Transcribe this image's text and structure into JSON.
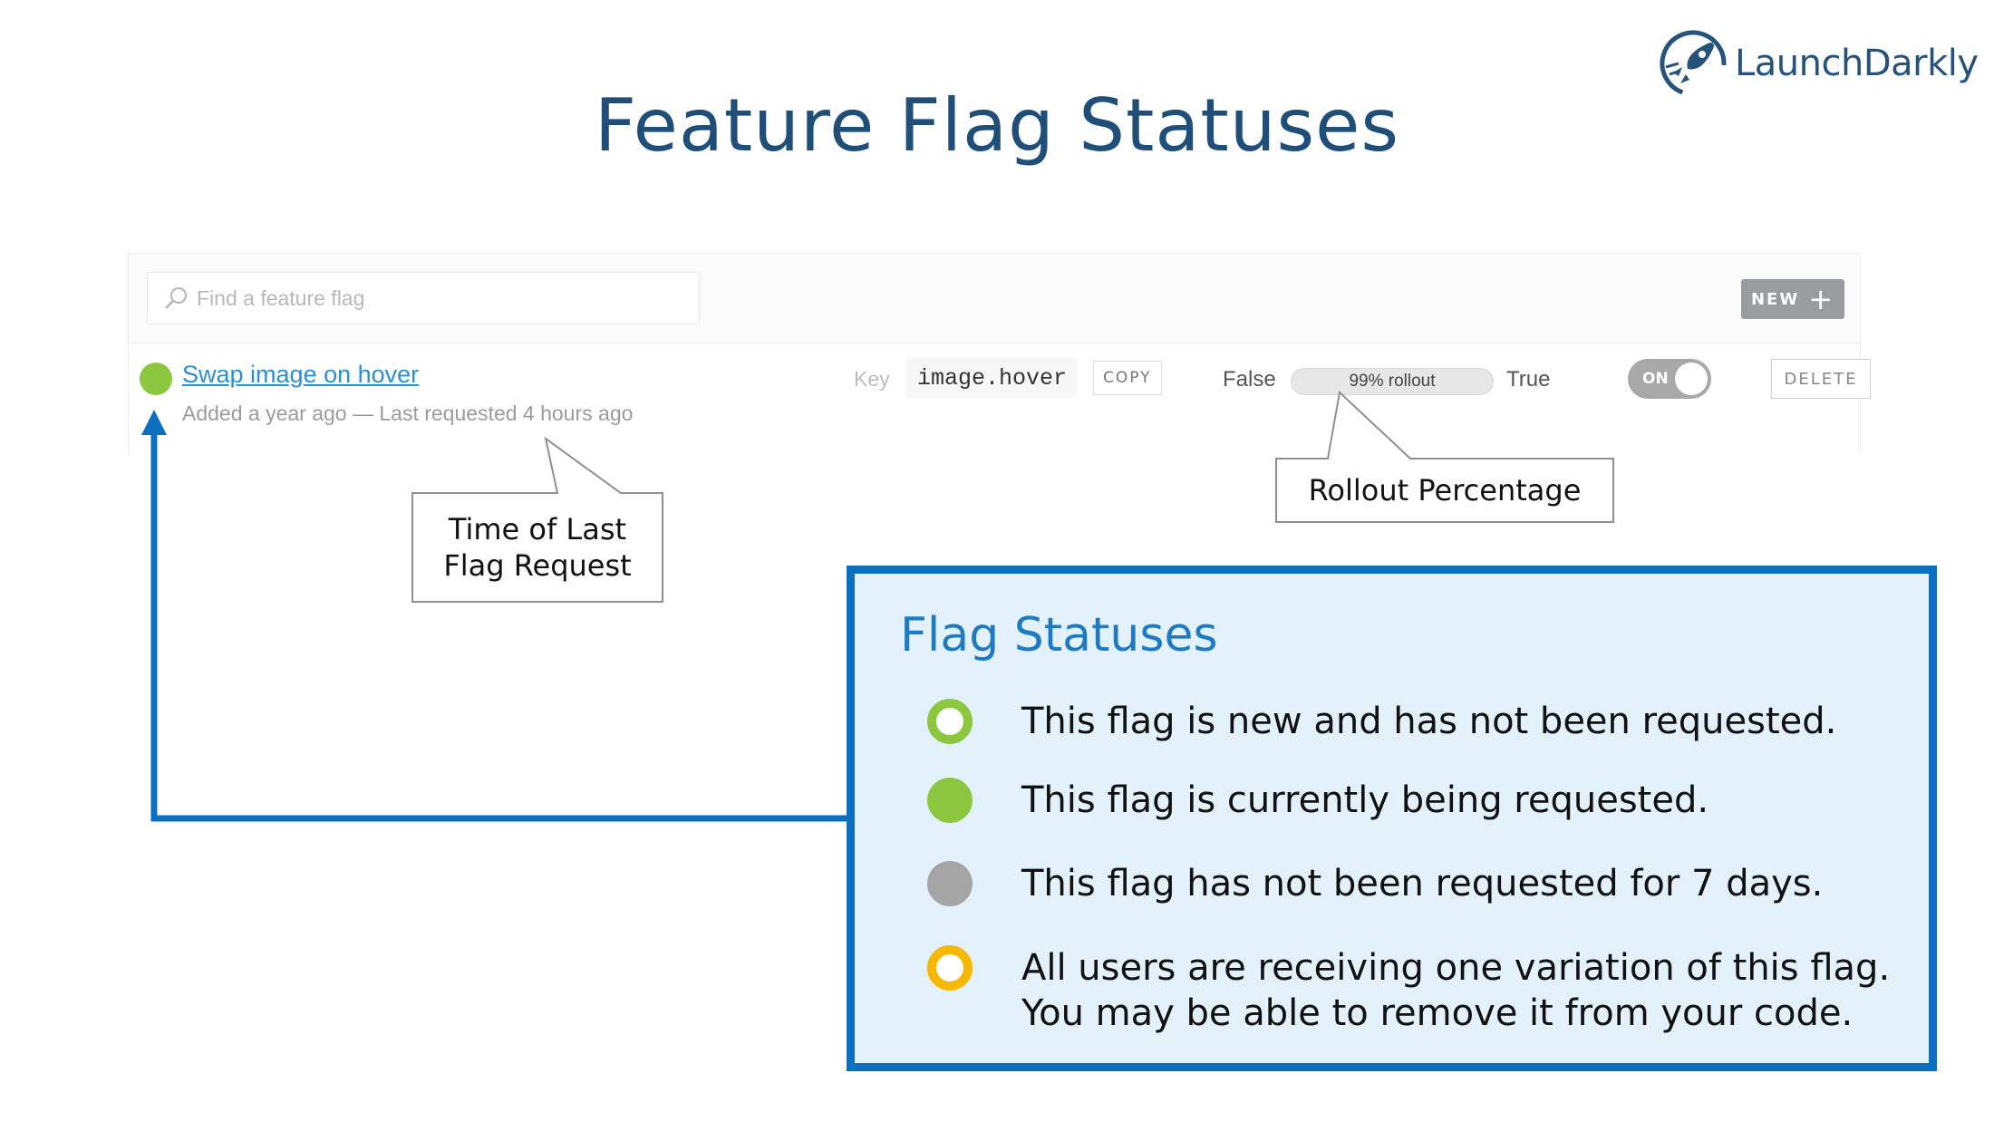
{
  "slide": {
    "title": "Feature Flag Statuses"
  },
  "logo": {
    "text": "LaunchDarkly"
  },
  "toolbar": {
    "search_placeholder": "Find a feature flag",
    "new_label": "NEW",
    "new_icon": "plus-icon"
  },
  "flag": {
    "name": "Swap image on hover",
    "meta": "Added a year ago — Last requested 4 hours ago",
    "key_label": "Key",
    "key_value": "image.hover",
    "copy_label": "COPY",
    "false_label": "False",
    "rollout_label": "99% rollout",
    "rollout_percent": 99,
    "true_label": "True",
    "toggle_label": "ON",
    "toggle_state": "on",
    "delete_label": "DELETE",
    "status": "live"
  },
  "callouts": {
    "time": [
      "Time of Last",
      "Flag Request"
    ],
    "rollout": "Rollout Percentage"
  },
  "legend": {
    "title": "Flag Statuses",
    "items": [
      {
        "status": "new",
        "lines": [
          "This flag is new and has not been requested."
        ]
      },
      {
        "status": "live",
        "lines": [
          "This flag is currently being requested."
        ]
      },
      {
        "status": "inactive",
        "lines": [
          "This flag has not been requested for 7 days."
        ]
      },
      {
        "status": "launched",
        "lines": [
          "All users are receiving one variation of this flag.",
          "You may be able to remove it from your code."
        ]
      }
    ]
  },
  "colors": {
    "title": "#1f4e79",
    "accent_blue": "#0d6fbf",
    "legend_bg": "#e3f1fb",
    "status_green": "#8dc63f",
    "status_gray": "#a5a5a5",
    "status_yellow": "#f6b800",
    "link": "#2b8fd5"
  }
}
